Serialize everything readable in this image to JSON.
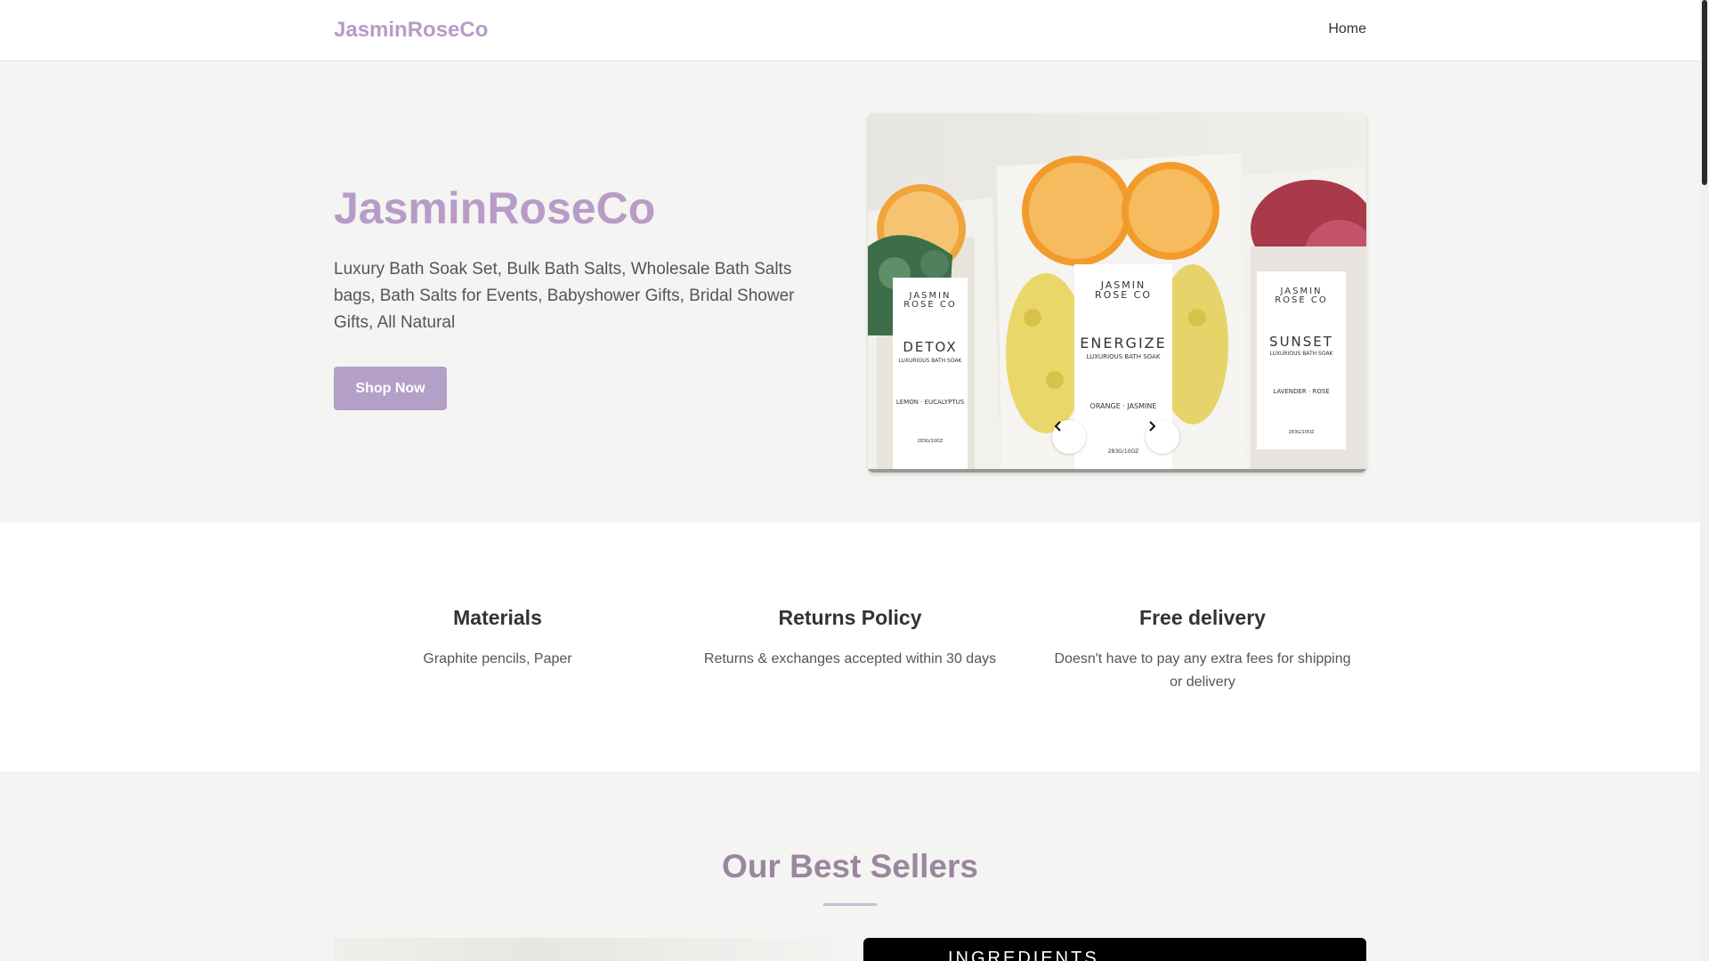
{
  "nav": {
    "brand": "JasminRoseCo",
    "home": "Home"
  },
  "hero": {
    "title": "JasminRoseCo",
    "description": "Luxury Bath Soak Set, Bulk Bath Salts, Wholesale Bath Salts bags, Bath Salts for Events, Babyshower Gifts, Bridal Shower Gifts, All Natural",
    "cta": "Shop Now",
    "carousel": {
      "products": [
        {
          "brand_line1": "JASMIN",
          "brand_line2": "ROSE CO",
          "name": "DETOX",
          "sub": "LUXURIOUS BATH SOAK",
          "scent": "LEMON · EUCALYPTUS",
          "weight": "283G/10OZ"
        },
        {
          "brand_line1": "JASMIN",
          "brand_line2": "ROSE CO",
          "name": "ENERGIZE",
          "sub": "LUXURIOUS BATH SOAK",
          "scent": "ORANGE · JASMINE",
          "weight": "283G/10OZ"
        },
        {
          "brand_line1": "JASMIN",
          "brand_line2": "ROSE CO",
          "name": "SUNSET",
          "sub": "LUXURIOUS BATH SOAK",
          "scent": "LAVENDER · ROSE",
          "weight": "283G/10OZ"
        }
      ],
      "slide_count": 3,
      "active_slide": 1
    }
  },
  "features": [
    {
      "title": "Materials",
      "text": "Graphite pencils, Paper"
    },
    {
      "title": "Returns Policy",
      "text": "Returns & exchanges accepted within 30 days"
    },
    {
      "title": "Free delivery",
      "text": "Doesn't have to pay any extra fees for shipping or delivery"
    }
  ],
  "best_sellers": {
    "title": "Our Best Sellers",
    "card2_text": "INGREDIENTS"
  },
  "colors": {
    "brand": "#b89bc7",
    "button": "#b4a0c6",
    "section_bg": "#f4f4f2",
    "best_title": "#9b869f"
  },
  "icons": {
    "prev": "chevron-left-icon",
    "next": "chevron-right-icon"
  }
}
